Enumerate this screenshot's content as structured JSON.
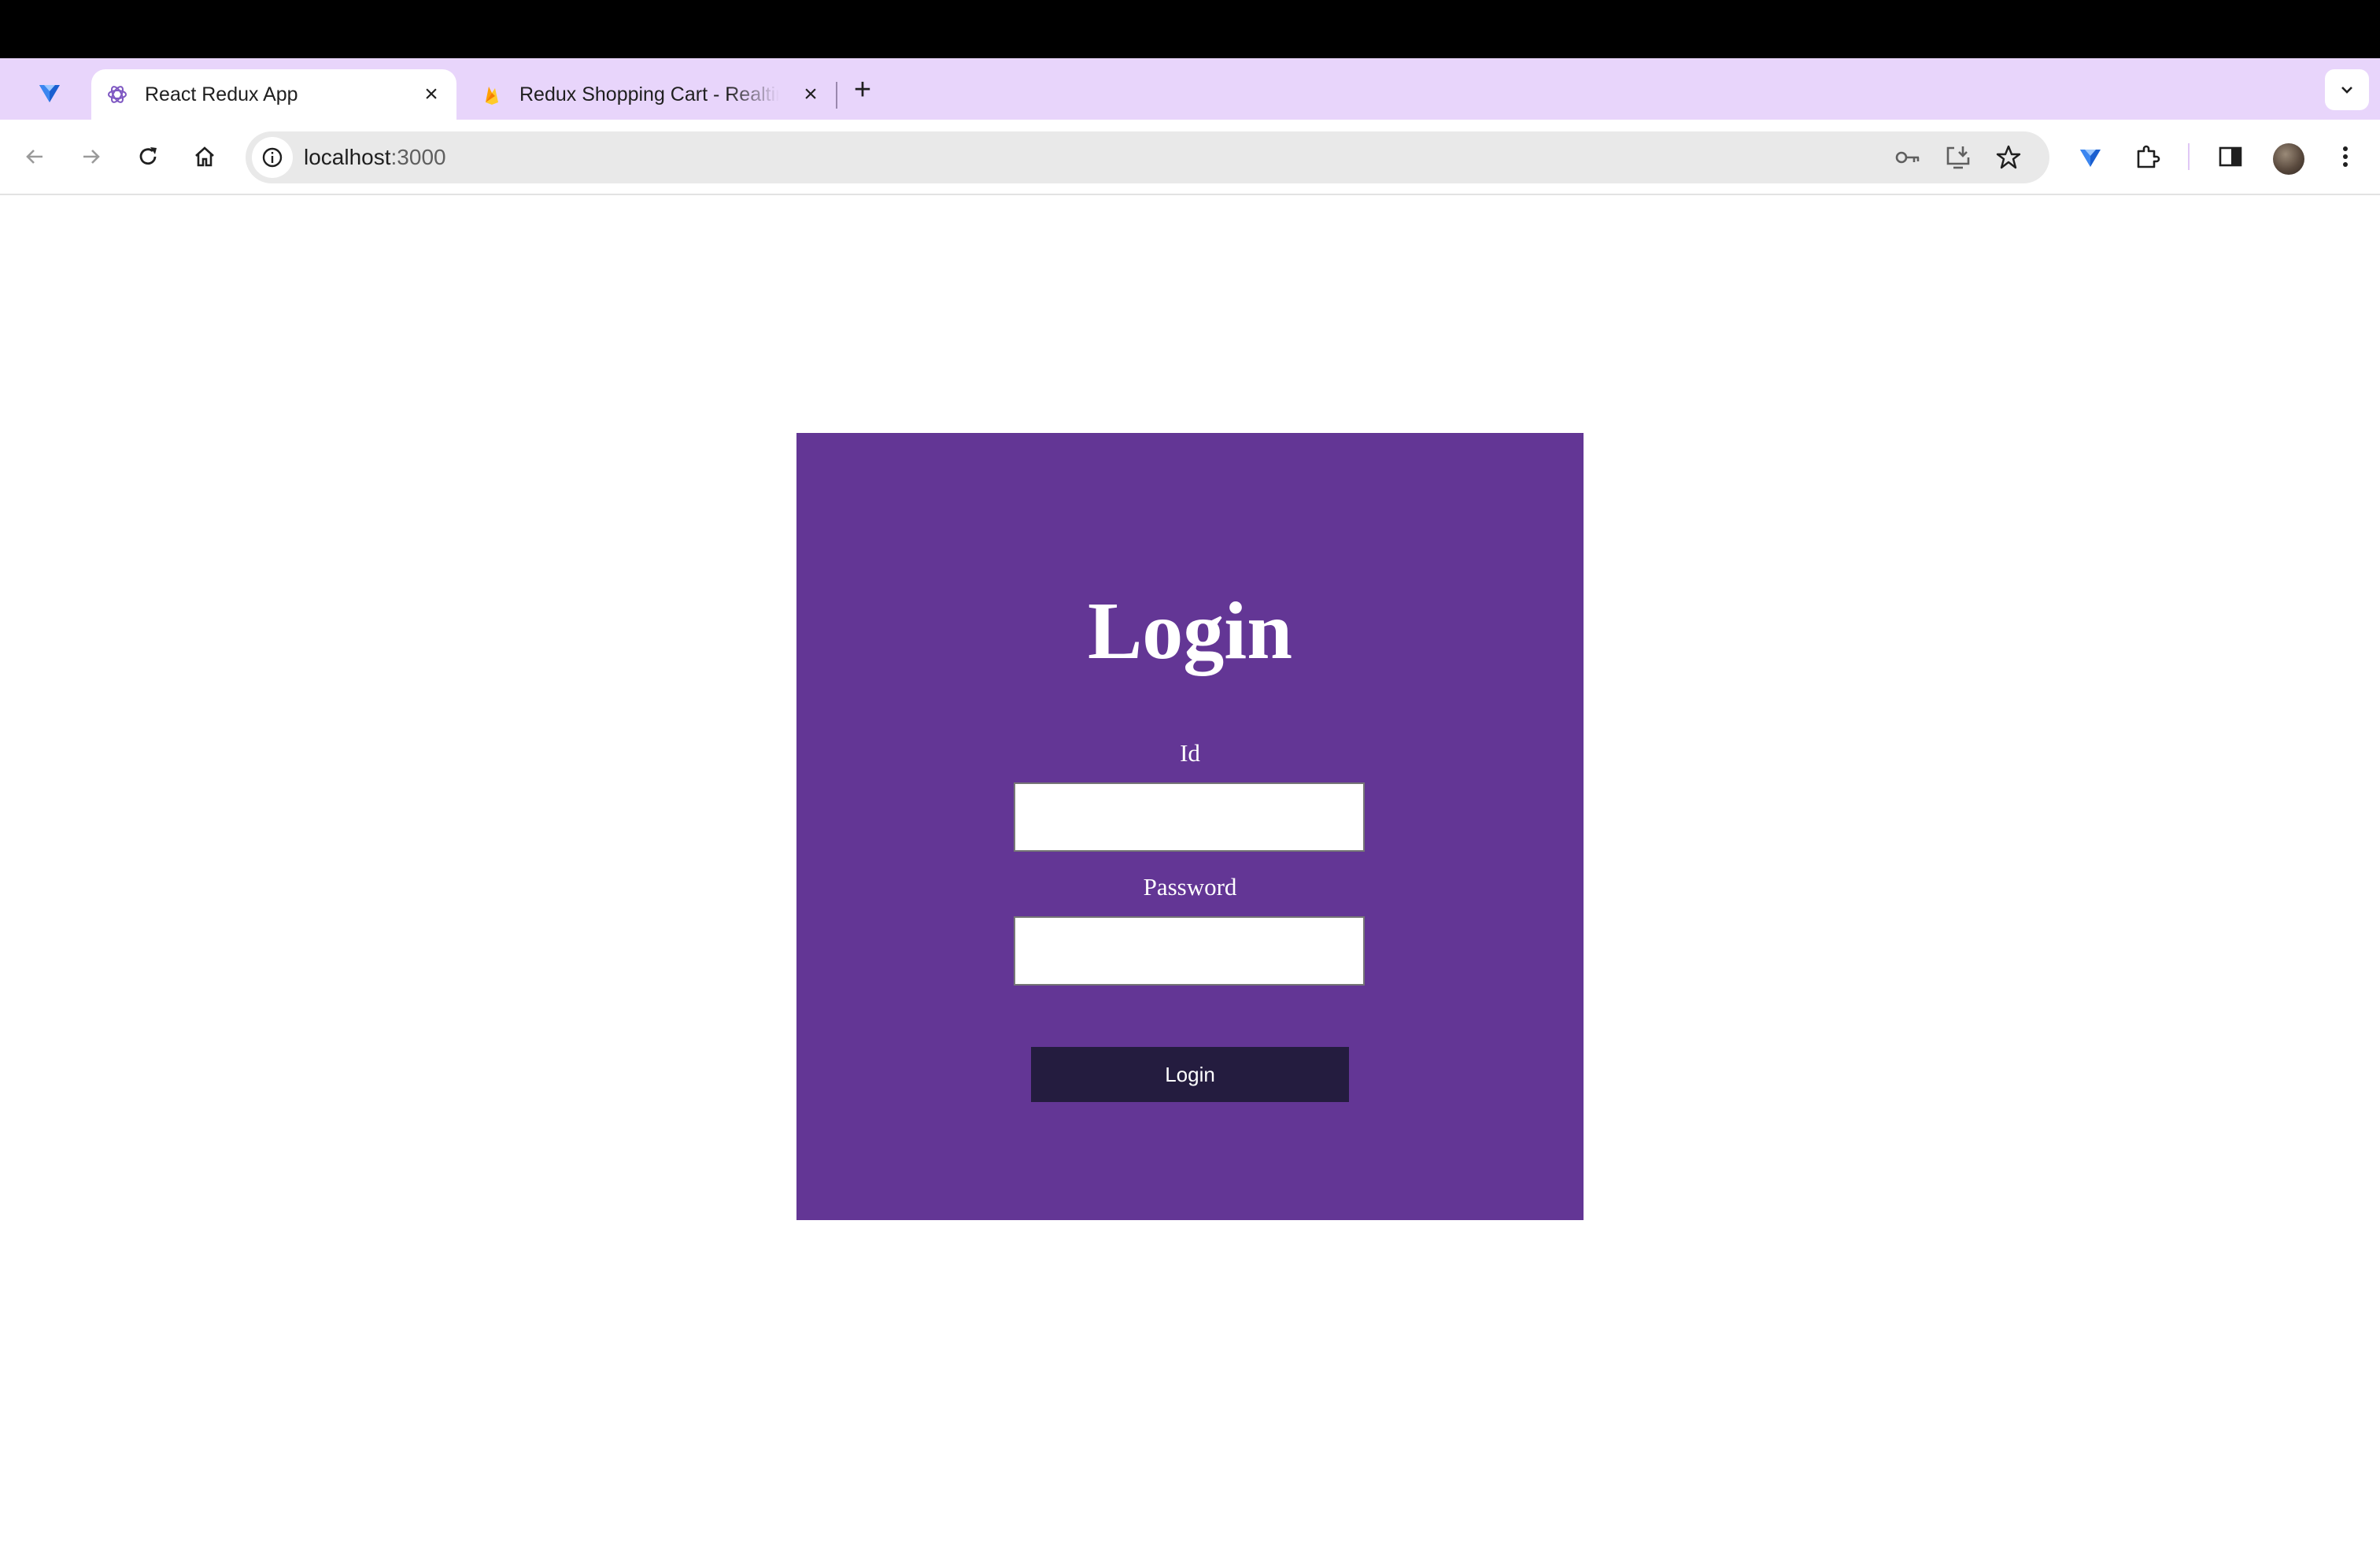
{
  "browser": {
    "tabs": [
      {
        "title": "React Redux App",
        "favicon": "react-redux-favicon",
        "active": true
      },
      {
        "title": "Redux Shopping Cart - Realtime",
        "favicon": "firebase-favicon",
        "active": false
      }
    ],
    "url_host": "localhost",
    "url_port": ":3000",
    "colors": {
      "tabstrip": "#e8d5fb",
      "chrome_black": "#000000"
    }
  },
  "login": {
    "title": "Login",
    "id_label": "Id",
    "id_value": "",
    "password_label": "Password",
    "password_value": "",
    "button_label": "Login",
    "colors": {
      "card": "#633695",
      "button": "#241c3f",
      "text": "#ffffff"
    }
  }
}
